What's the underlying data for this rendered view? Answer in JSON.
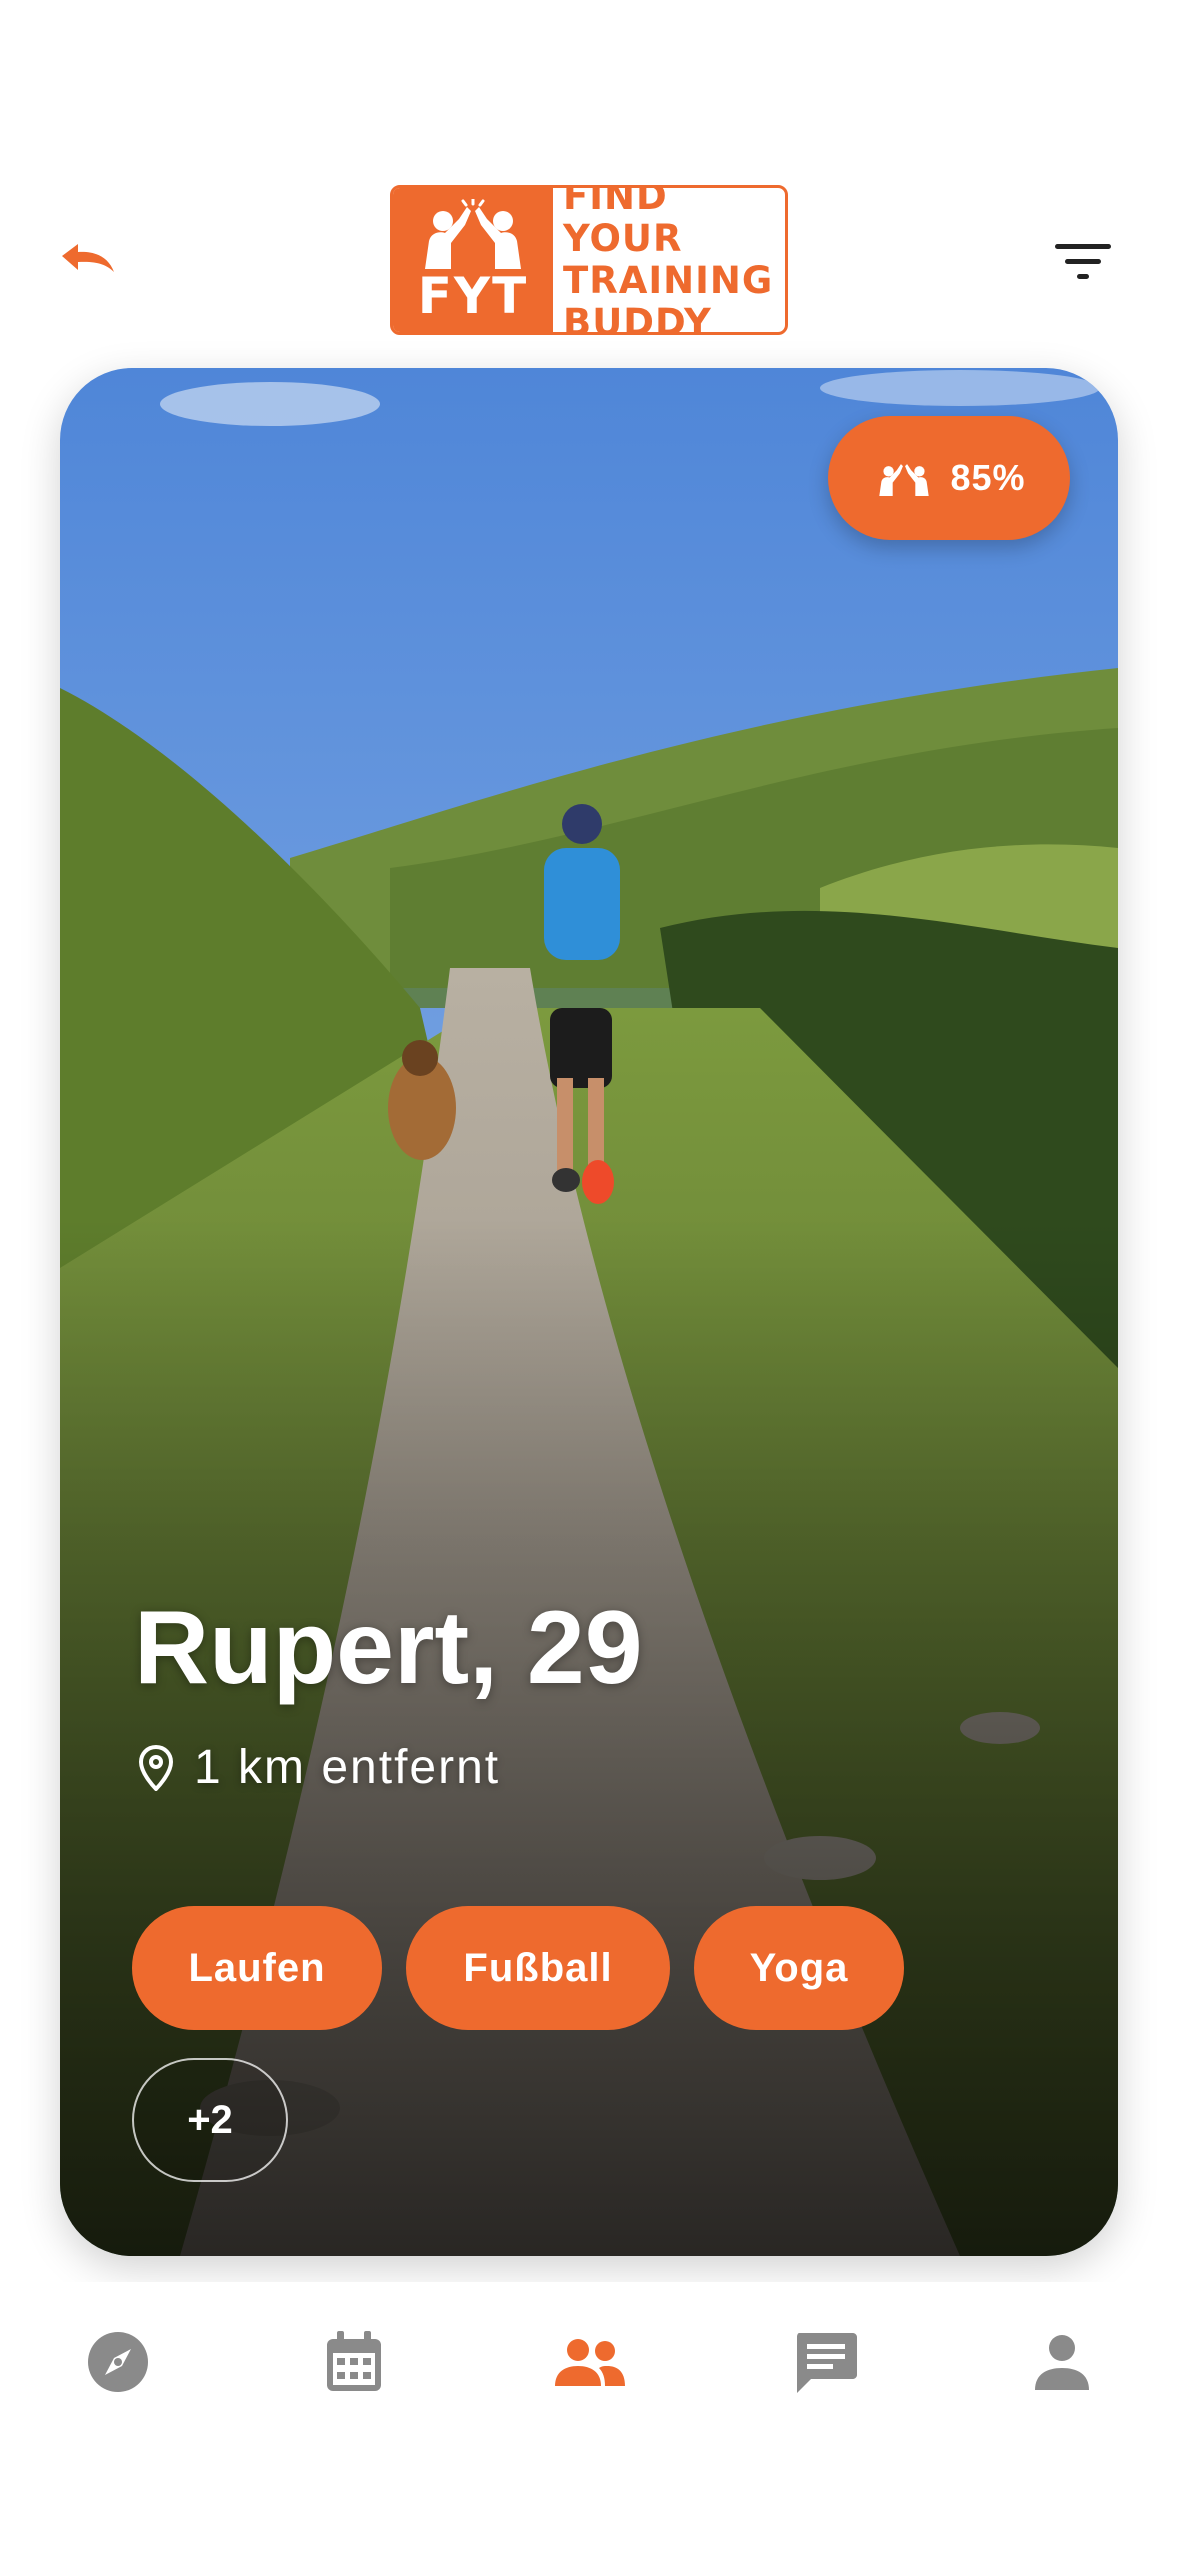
{
  "header": {
    "back_icon": "undo-arrow-icon",
    "filter_icon": "filter-lines-icon",
    "logo": {
      "short": "FYT",
      "line1": "FIND YOUR",
      "line2": "TRAINING",
      "line3": "BUDDY"
    }
  },
  "profile": {
    "match_percent": "85%",
    "name_age": "Rupert, 29",
    "location_icon": "location-pin-icon",
    "distance": "1  km entfernt",
    "tags": [
      "Laufen",
      "Fußball",
      "Yoga"
    ],
    "more_tags": "+2"
  },
  "bottom_nav": {
    "items": [
      {
        "icon": "compass-icon",
        "active": false
      },
      {
        "icon": "calendar-icon",
        "active": false
      },
      {
        "icon": "people-icon",
        "active": true
      },
      {
        "icon": "chat-icon",
        "active": false
      },
      {
        "icon": "person-icon",
        "active": false
      }
    ]
  },
  "colors": {
    "accent": "#ee6a2e",
    "nav_inactive": "#8a8a8a",
    "icon_dark": "#222222"
  }
}
